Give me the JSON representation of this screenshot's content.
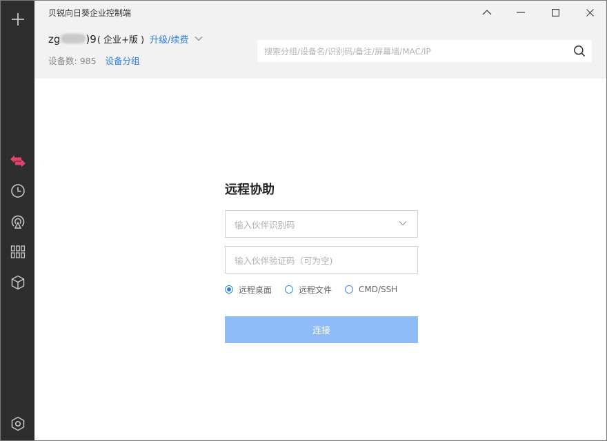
{
  "window": {
    "title": "贝锐向日葵企业控制端"
  },
  "account": {
    "name_prefix": "zg",
    "name_suffix": ")9",
    "edition": "( 企业+版 )",
    "upgrade_label": "升级/续费",
    "device_count_label": "设备数:",
    "device_count": "985",
    "device_group_label": "设备分组"
  },
  "search": {
    "placeholder": "搜索分组/设备名/识别码/备注/屏幕墙/MAC/IP"
  },
  "remote_assist": {
    "title": "远程协助",
    "partner_id_placeholder": "输入伙伴识别码",
    "verify_code_placeholder": "输入伙伴验证码（可为空)",
    "modes": [
      {
        "label": "远程桌面",
        "selected": true
      },
      {
        "label": "远程文件",
        "selected": false
      },
      {
        "label": "CMD/SSH",
        "selected": false
      }
    ],
    "connect_label": "连接"
  },
  "sidebar": {
    "items": [
      {
        "icon": "plus-icon"
      },
      {
        "icon": "remote-control-icon",
        "active": true
      },
      {
        "icon": "clock-icon"
      },
      {
        "icon": "broadcast-icon"
      },
      {
        "icon": "apps-grid-icon"
      },
      {
        "icon": "cube-icon"
      },
      {
        "icon": "settings-hexagon-icon"
      }
    ]
  },
  "colors": {
    "sidebar_bg": "#2e2e2e",
    "active_icon": "#e8416b",
    "accent_link": "#2f7fe0",
    "connect_button": "#8fbcf6",
    "header_bg": "#f2f2f2"
  }
}
